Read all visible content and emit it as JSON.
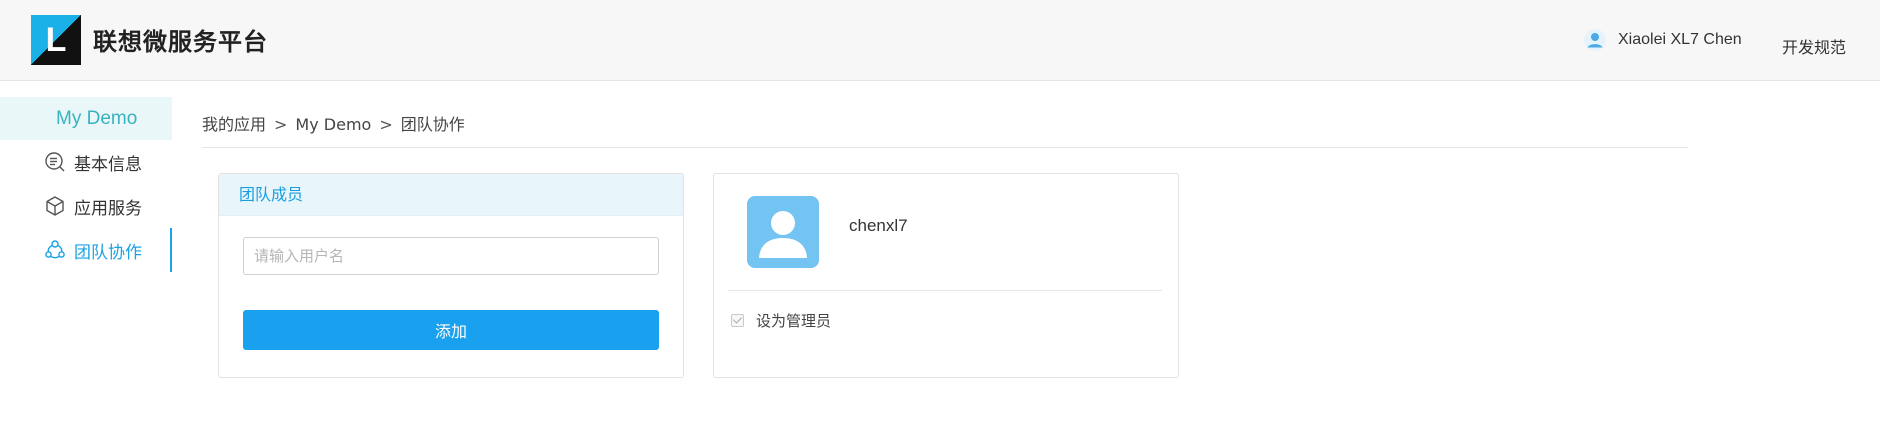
{
  "header": {
    "logo_letter": "L",
    "brand": "联想微服务平台",
    "user_name": "Xiaolei XL7 Chen",
    "dev_link": "开发规范"
  },
  "sidebar": {
    "title": "My Demo",
    "items": [
      {
        "label": "基本信息",
        "icon": "list-search-icon"
      },
      {
        "label": "应用服务",
        "icon": "cube-icon"
      },
      {
        "label": "团队协作",
        "icon": "team-icon",
        "active": true
      }
    ]
  },
  "breadcrumb": {
    "items": [
      "我的应用",
      "My Demo",
      "团队协作"
    ],
    "separator": ">"
  },
  "team_card": {
    "title": "团队成员",
    "input_placeholder": "请输入用户名",
    "input_value": "",
    "add_button": "添加"
  },
  "member_card": {
    "name": "chenxl7",
    "admin_label": "设为管理员",
    "admin_checked": true
  },
  "colors": {
    "accent": "#1ba2e6",
    "sidebar_title": "#39b3c0",
    "button": "#19a0ee"
  }
}
